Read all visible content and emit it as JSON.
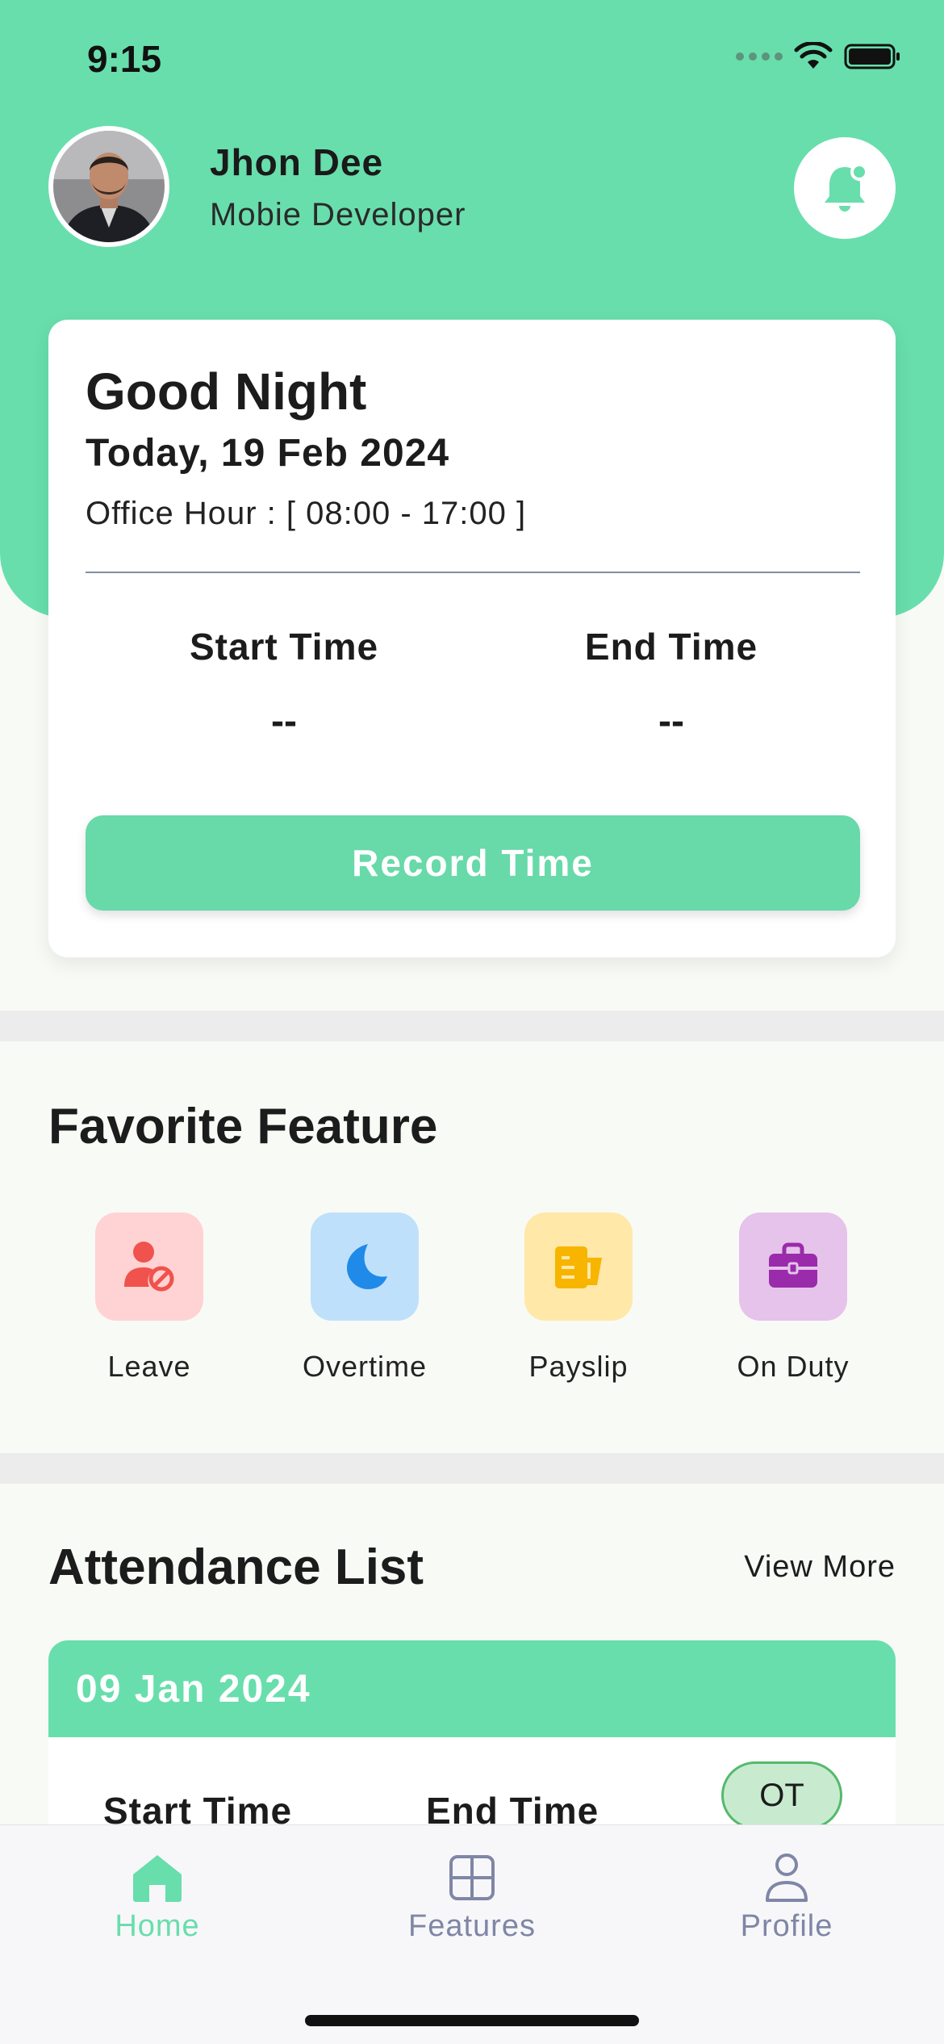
{
  "status_bar": {
    "time": "9:15"
  },
  "profile": {
    "name": "Jhon Dee",
    "role": "Mobie Developer"
  },
  "time_card": {
    "greeting": "Good Night",
    "date": "Today, 19 Feb 2024",
    "office_hour": "Office Hour : [ 08:00 - 17:00 ]",
    "start_label": "Start Time",
    "start_value": "--",
    "end_label": "End Time",
    "end_value": "--",
    "record_button": "Record Time"
  },
  "favorites": {
    "title": "Favorite Feature",
    "items": [
      {
        "label": "Leave",
        "icon": "user-blocked-icon",
        "tile_color": "#ffd3d3",
        "icon_color": "#f0524d"
      },
      {
        "label": "Overtime",
        "icon": "moon-icon",
        "tile_color": "#bfe0fb",
        "icon_color": "#1f8ae8"
      },
      {
        "label": "Payslip",
        "icon": "payslip-icon",
        "tile_color": "#ffe8a8",
        "icon_color": "#f7b500"
      },
      {
        "label": "On Duty",
        "icon": "briefcase-icon",
        "tile_color": "#e6c3ea",
        "icon_color": "#9a2bab"
      }
    ]
  },
  "attendance": {
    "title": "Attendance List",
    "view_more": "View More",
    "first_entry": {
      "date": "09 Jan 2024",
      "start_label": "Start Time",
      "end_label": "End Time",
      "badge": "OT"
    }
  },
  "tab_bar": {
    "tabs": [
      {
        "label": "Home",
        "icon": "home-icon",
        "active": true
      },
      {
        "label": "Features",
        "icon": "layout-icon",
        "active": false
      },
      {
        "label": "Profile",
        "icon": "user-icon",
        "active": false
      }
    ]
  },
  "colors": {
    "accent": "#68deac",
    "tab_active": "#68deac",
    "tab_inactive": "#7f86a6"
  }
}
